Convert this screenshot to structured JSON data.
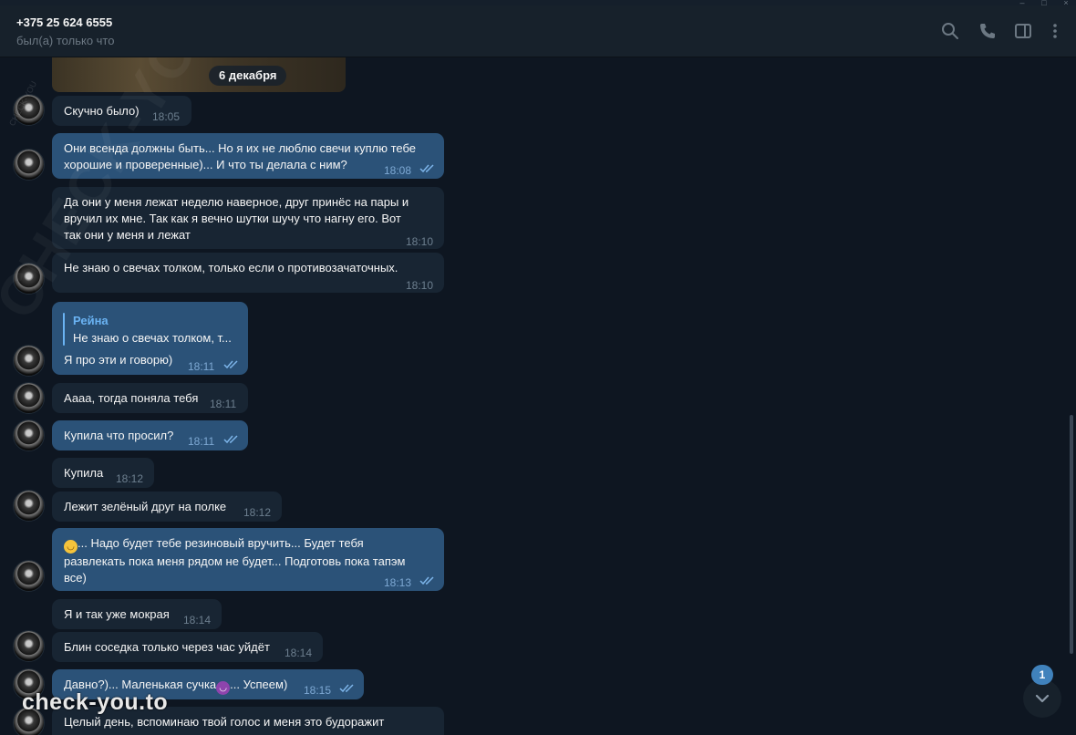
{
  "header": {
    "peer_name": "+375 25 624 6555",
    "peer_status": "был(а) только что",
    "icons": [
      "search-icon",
      "phone-icon",
      "sidebar-toggle-icon",
      "more-vertical-icon"
    ]
  },
  "chat": {
    "date_separator": "6 декабря",
    "messages": [
      {
        "dir": "in",
        "text": "Скучно было)",
        "time": "18:05"
      },
      {
        "dir": "out",
        "text_lines": [
          "Они всенда должны быть... Но я их не люблю свечи куплю тебе",
          "хорошие и проверенные)... И что ты делала с ним?"
        ],
        "time": "18:08",
        "read": true
      },
      {
        "dir": "in",
        "text_lines": [
          "Да они у меня лежат неделю наверное, друг принёс на пары и",
          "вручил их мне. Так как я вечно шутки шучу что нагну его. Вот",
          "так они у меня и лежат"
        ],
        "time": "18:10"
      },
      {
        "dir": "in",
        "text": "Не знаю о свечах толком, только если о противозачаточных.",
        "time": "18:10"
      },
      {
        "dir": "out",
        "reply_name": "Рейна",
        "reply_text": "Не знаю о свечах толком, т...",
        "text": "Я про эти и говорю)",
        "time": "18:11",
        "read": true
      },
      {
        "dir": "in",
        "text": "Аааа, тогда поняла тебя",
        "time": "18:11"
      },
      {
        "dir": "out",
        "text": "Купила что просил?",
        "time": "18:11",
        "read": true
      },
      {
        "dir": "in",
        "text": "Купила",
        "time": "18:12"
      },
      {
        "dir": "in",
        "text": "Лежит зелёный друг на полке",
        "time": "18:12"
      },
      {
        "dir": "out",
        "emoji": "laughing-emoji",
        "text_lines": [
          "... Надо будет тебе резиновый вручить... Будет тебя",
          "развлекать пока меня рядом не будет... Подготовь пока тапэм",
          "все)"
        ],
        "time": "18:13",
        "read": true
      },
      {
        "dir": "in",
        "text": "Я и так уже мокрая",
        "time": "18:14"
      },
      {
        "dir": "in",
        "text": "Блин соседка только через час уйдёт",
        "time": "18:14"
      },
      {
        "dir": "out",
        "text_before_emoji": "Давно?)... Маленькая сучка",
        "emoji": "devil-emoji",
        "text_after_emoji": "... Успеем)",
        "time": "18:15",
        "read": true
      },
      {
        "dir": "in",
        "text": "Целый день, вспоминаю твой голос и меня это будоражит"
      }
    ]
  },
  "scroll_down": {
    "unread_count": "1"
  },
  "watermarks": {
    "corner": "check-you.to",
    "diagonal": "CHECK-YOU.ME",
    "small": "CHECK-YOU"
  },
  "colors": {
    "background": "#0e1621",
    "header": "#17212b",
    "incoming_bubble": "#182533",
    "outgoing_bubble": "#2b5278",
    "accent": "#6ab3f3",
    "badge": "#4082bc"
  }
}
